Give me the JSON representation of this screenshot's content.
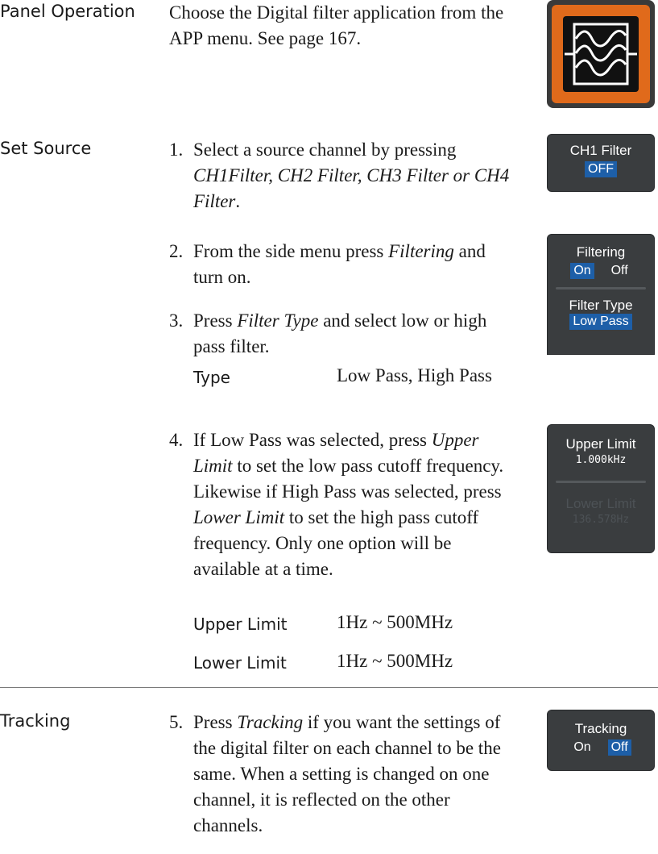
{
  "panel_operation": {
    "label": "Panel Operation",
    "text": "Choose the Digital filter application from the APP menu. See page 167.",
    "icon": "digital-filter-app-icon"
  },
  "set_source": {
    "label": "Set Source",
    "steps": [
      {
        "num": "1.",
        "text_before": "Select a source channel by pressing ",
        "italic": "CH1Filter, CH2 Filter, CH3 Filter or CH4 Filter",
        "text_after": "."
      },
      {
        "num": "2.",
        "text_before": "From the side menu press ",
        "italic": "Filtering",
        "text_after": " and turn on."
      },
      {
        "num": "3.",
        "text_before": "Press ",
        "italic": "Filter Type",
        "text_after": " and select low or high pass filter."
      },
      {
        "num": "4.",
        "text_before": "If Low Pass was selected, press ",
        "italic": "Upper Limit",
        "text_mid": " to set the low pass cutoff frequency. Likewise if High Pass was selected, press ",
        "italic2": "Lower Limit",
        "text_after": " to set the high pass cutoff frequency. Only one option will be available at a time."
      }
    ],
    "type_row": {
      "key": "Type",
      "value": "Low Pass, High Pass"
    },
    "limits": [
      {
        "key": "Upper Limit",
        "value": "1Hz ~ 500MHz"
      },
      {
        "key": "Lower Limit",
        "value": "1Hz ~ 500MHz"
      }
    ]
  },
  "tracking": {
    "label": "Tracking",
    "step": {
      "num": "5.",
      "text_before": "Press ",
      "italic": "Tracking",
      "text_after": " if you want the settings of the digital filter on each channel to be the same. When a setting is changed on one channel, it is reflected on the other channels."
    }
  },
  "softkeys": {
    "ch1_filter": {
      "title": "CH1 Filter",
      "value": "OFF"
    },
    "filtering": {
      "title": "Filtering",
      "on": "On",
      "off": "Off",
      "selected": "On"
    },
    "filter_type": {
      "title": "Filter Type",
      "value": "Low Pass"
    },
    "upper_limit": {
      "title": "Upper Limit",
      "value": "1.000kHz"
    },
    "lower_limit": {
      "title": "Lower Limit",
      "value": "136.578Hz"
    },
    "tracking": {
      "title": "Tracking",
      "on": "On",
      "off": "Off",
      "selected": "Off"
    }
  },
  "colors": {
    "softkey_bg": "#3a3d3f",
    "softkey_highlight": "#1d5fa8",
    "app_icon_orange": "#e06a1b"
  }
}
